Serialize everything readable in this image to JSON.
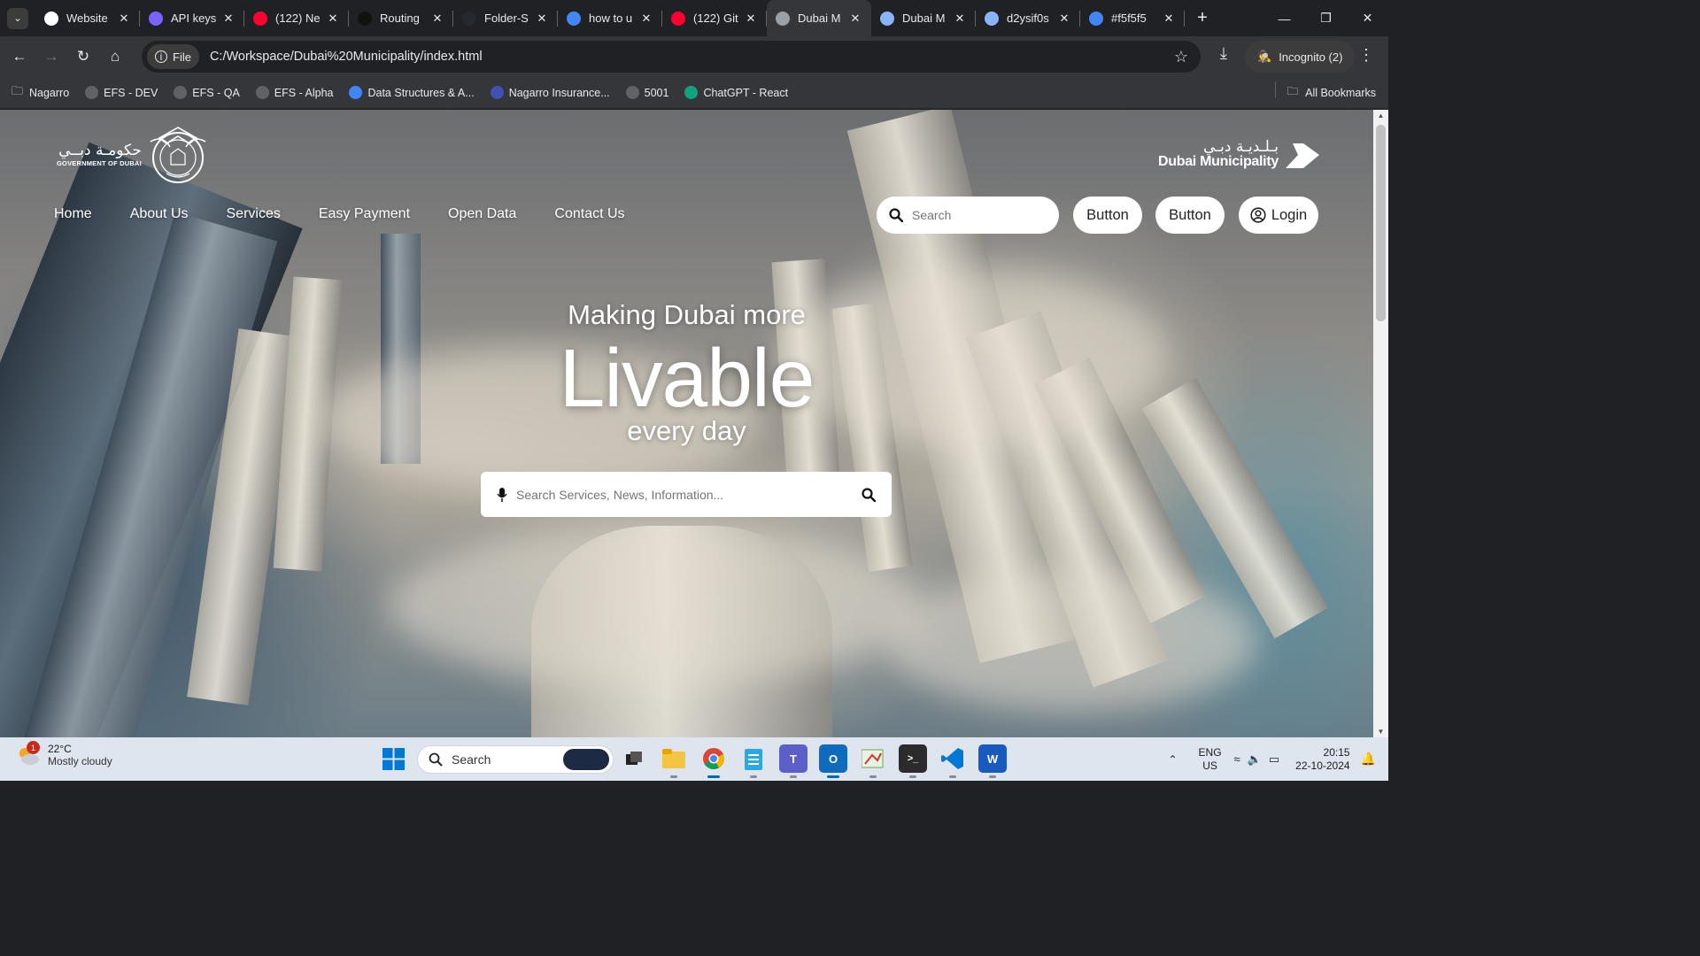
{
  "browser": {
    "tabs": [
      {
        "title": "Website",
        "icon": "openai-icon",
        "color": "#ffffff"
      },
      {
        "title": "API keys",
        "icon": "openai-icon",
        "color": "#7b61ff"
      },
      {
        "title": "(122) Ne",
        "icon": "youtube-icon",
        "color": "#ff0033"
      },
      {
        "title": "Routing",
        "icon": "notion-icon",
        "color": "#111111"
      },
      {
        "title": "Folder-S",
        "icon": "github-icon",
        "color": "#24292f"
      },
      {
        "title": "how to u",
        "icon": "google-icon",
        "color": "#4285f4"
      },
      {
        "title": "(122) Git",
        "icon": "youtube-icon",
        "color": "#ff0033"
      },
      {
        "title": "Dubai M",
        "icon": "globe-icon",
        "color": "#9aa0a6",
        "active": true
      },
      {
        "title": "Dubai M",
        "icon": "feather-icon",
        "color": "#8ab4f8"
      },
      {
        "title": "d2ysif0s",
        "icon": "feather-icon",
        "color": "#8ab4f8"
      },
      {
        "title": "#f5f5f5",
        "icon": "google-icon",
        "color": "#4285f4"
      }
    ],
    "file_chip": "File",
    "url": "C:/Workspace/Dubai%20Municipality/index.html",
    "incognito_label": "Incognito (2)",
    "bookmarks": [
      {
        "label": "Nagarro",
        "icon": "folder-icon"
      },
      {
        "label": "EFS - DEV",
        "icon": "globe-icon"
      },
      {
        "label": "EFS - QA",
        "icon": "globe-icon"
      },
      {
        "label": "EFS - Alpha",
        "icon": "globe-icon"
      },
      {
        "label": "Data Structures & A...",
        "icon": "google-icon"
      },
      {
        "label": "Nagarro Insurance...",
        "icon": "nagarro-icon"
      },
      {
        "label": "5001",
        "icon": "globe-icon"
      },
      {
        "label": "ChatGPT - React",
        "icon": "openai-icon"
      }
    ],
    "all_bookmarks": "All Bookmarks"
  },
  "site": {
    "gov_logo_ar": "حكومـة دبــي",
    "gov_logo_en": "GOVERNMENT OF DUBAI",
    "dm_logo_ar": "بـلـديـة دبـي",
    "dm_logo_en": "Dubai Municipality",
    "nav": [
      "Home",
      "About Us",
      "Services",
      "Easy Payment",
      "Open Data",
      "Contact Us"
    ],
    "header_search_placeholder": "Search",
    "button_1": "Button",
    "button_2": "Button",
    "login": "Login",
    "hero_line1": "Making Dubai more",
    "hero_line2": "Livable",
    "hero_line3": "every day",
    "hero_search_placeholder": "Search Services, News, Information..."
  },
  "taskbar": {
    "weather_temp": "22°C",
    "weather_desc": "Mostly cloudy",
    "weather_badge": "1",
    "search_label": "Search",
    "lang_1": "ENG",
    "lang_2": "US",
    "time": "20:15",
    "date": "22-10-2024"
  }
}
